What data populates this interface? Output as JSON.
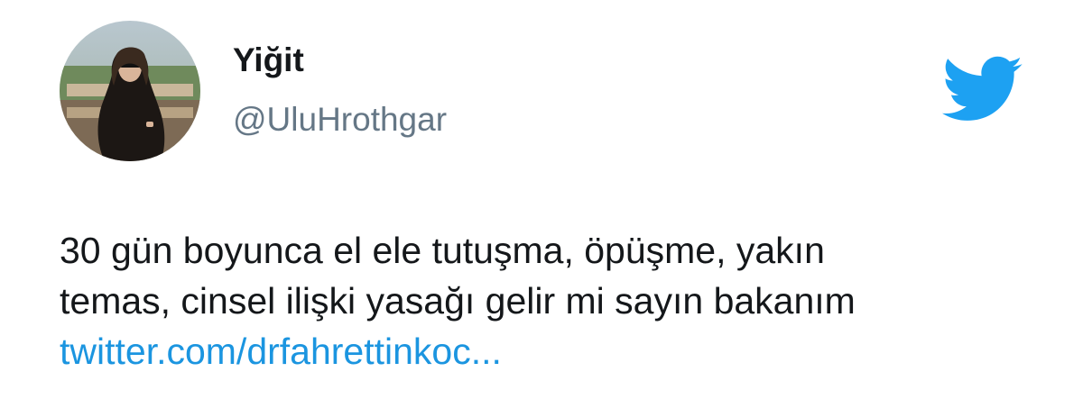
{
  "author": {
    "display_name": "Yiğit",
    "handle": "@UluHrothgar"
  },
  "brand": {
    "icon": "twitter-bird-icon",
    "color": "#1da1f2"
  },
  "tweet": {
    "lines": [
      "30 gün boyunca el ele tutuşma, öpüşme, yakın",
      "temas, cinsel ilişki yasağı gelir mi sayın bakanım"
    ],
    "link": "twitter.com/drfahrettinkoc..."
  },
  "colors": {
    "text": "#14171a",
    "secondary": "#657786",
    "link": "#1b95e0"
  }
}
